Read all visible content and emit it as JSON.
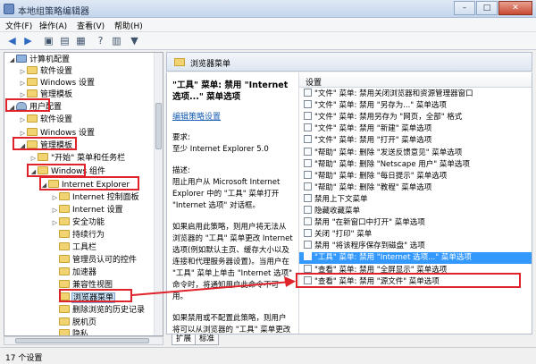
{
  "window": {
    "title": "本地组策略编辑器",
    "min": "–",
    "max": "□",
    "close": "✕"
  },
  "menu": [
    "文件(F)",
    "操作(A)",
    "查看(V)",
    "帮助(H)"
  ],
  "tree": [
    {
      "label": "计算机配置",
      "exp": "◢",
      "icon": "pc"
    },
    {
      "label": "软件设置",
      "exp": "▷",
      "icon": "folder"
    },
    {
      "label": "Windows 设置",
      "exp": "▷",
      "icon": "folder"
    },
    {
      "label": "管理模板",
      "exp": "▷",
      "icon": "folder"
    },
    {
      "label": "用户配置",
      "exp": "◢",
      "icon": "user"
    },
    {
      "label": "软件设置",
      "exp": "▷",
      "icon": "folder"
    },
    {
      "label": "Windows 设置",
      "exp": "▷",
      "icon": "folder"
    },
    {
      "label": "管理模板",
      "exp": "◢",
      "icon": "folder"
    },
    {
      "label": "\"开始\" 菜单和任务栏",
      "exp": "▷",
      "icon": "folder"
    },
    {
      "label": "Windows 组件",
      "exp": "◢",
      "icon": "folder"
    },
    {
      "label": "Internet Explorer",
      "exp": "◢",
      "icon": "folder"
    },
    {
      "label": "Internet 控制面板",
      "exp": "▷",
      "icon": "folder"
    },
    {
      "label": "Internet 设置",
      "exp": "▷",
      "icon": "folder"
    },
    {
      "label": "安全功能",
      "exp": "▷",
      "icon": "folder"
    },
    {
      "label": "持续行为",
      "exp": "",
      "icon": "folder"
    },
    {
      "label": "工具栏",
      "exp": "",
      "icon": "folder"
    },
    {
      "label": "管理员认可的控件",
      "exp": "",
      "icon": "folder"
    },
    {
      "label": "加速器",
      "exp": "",
      "icon": "folder"
    },
    {
      "label": "兼容性视图",
      "exp": "",
      "icon": "folder"
    },
    {
      "label": "浏览器菜单",
      "exp": "",
      "icon": "folder"
    },
    {
      "label": "删除浏览的历史记录",
      "exp": "",
      "icon": "folder"
    },
    {
      "label": "脱机页",
      "exp": "",
      "icon": "folder"
    },
    {
      "label": "隐私",
      "exp": "",
      "icon": "folder"
    }
  ],
  "pane": {
    "header": "浏览器菜单",
    "policy_title": "\"工具\" 菜单: 禁用 \"Internet 选项...\" 菜单选项",
    "edit_prefix": "编辑",
    "edit_link": "策略设置",
    "req_label": "要求:",
    "req_value": "至少 Internet Explorer 5.0",
    "desc_label": "描述:",
    "desc_1": "阻止用户从 Microsoft Internet Explorer 中的 \"工具\" 菜单打开 \"Internet 选项\" 对话框。",
    "desc_2": "如果启用此策略，则用户将无法从浏览器的 \"工具\" 菜单更改 Internet 选项(例如默认主页、缓存大小以及连接和代理服务器设置)。当用户在 \"工具\" 菜单上单击 \"Internet 选项\" 命令时，将通知用户此命令不可用。",
    "desc_3": "如果禁用或不配置此策略，则用户将可以从浏览器的 \"工具\" 菜单更改 Internet 设置。"
  },
  "list": {
    "column": "设置",
    "items": [
      {
        "text": "\"文件\" 菜单: 禁用关闭浏览器和资源管理器窗口",
        "kind": "policy"
      },
      {
        "text": "\"文件\" 菜单: 禁用 \"另存为...\" 菜单选项",
        "kind": "policy"
      },
      {
        "text": "\"文件\" 菜单: 禁用另存为 \"网页，全部\" 格式",
        "kind": "policy"
      },
      {
        "text": "\"文件\" 菜单: 禁用 \"新建\" 菜单选项",
        "kind": "policy"
      },
      {
        "text": "\"文件\" 菜单: 禁用 \"打开\" 菜单选项",
        "kind": "policy"
      },
      {
        "text": "\"帮助\" 菜单: 删除 \"发送反馈意见\" 菜单选项",
        "kind": "policy"
      },
      {
        "text": "\"帮助\" 菜单: 删除 \"Netscape 用户\" 菜单选项",
        "kind": "policy"
      },
      {
        "text": "\"帮助\" 菜单: 删除 \"每日提示\" 菜单选项",
        "kind": "policy"
      },
      {
        "text": "\"帮助\" 菜单: 删除 \"教程\" 菜单选项",
        "kind": "policy"
      },
      {
        "text": "禁用上下文菜单",
        "kind": "policy"
      },
      {
        "text": "隐藏收藏菜单",
        "kind": "policy"
      },
      {
        "text": "禁用 \"在新窗口中打开\" 菜单选项",
        "kind": "policy"
      },
      {
        "text": "关闭 \"打印\" 菜单",
        "kind": "policy"
      },
      {
        "text": "禁用 \"将该程序保存到磁盘\" 选项",
        "kind": "policy"
      },
      {
        "text": "\"工具\" 菜单: 禁用 \"Internet 选项...\" 菜单选项",
        "kind": "policy"
      },
      {
        "text": "\"查看\" 菜单: 禁用 \"全屏显示\" 菜单选项",
        "kind": "policy"
      },
      {
        "text": "\"查看\" 菜单: 禁用 \"源文件\" 菜单选项",
        "kind": "policy"
      }
    ],
    "selected_index": 14
  },
  "tabs": [
    "扩展",
    "标准"
  ],
  "status": "17 个设置",
  "colors": {
    "highlight": "#e0222a",
    "selection": "#3399ff"
  }
}
